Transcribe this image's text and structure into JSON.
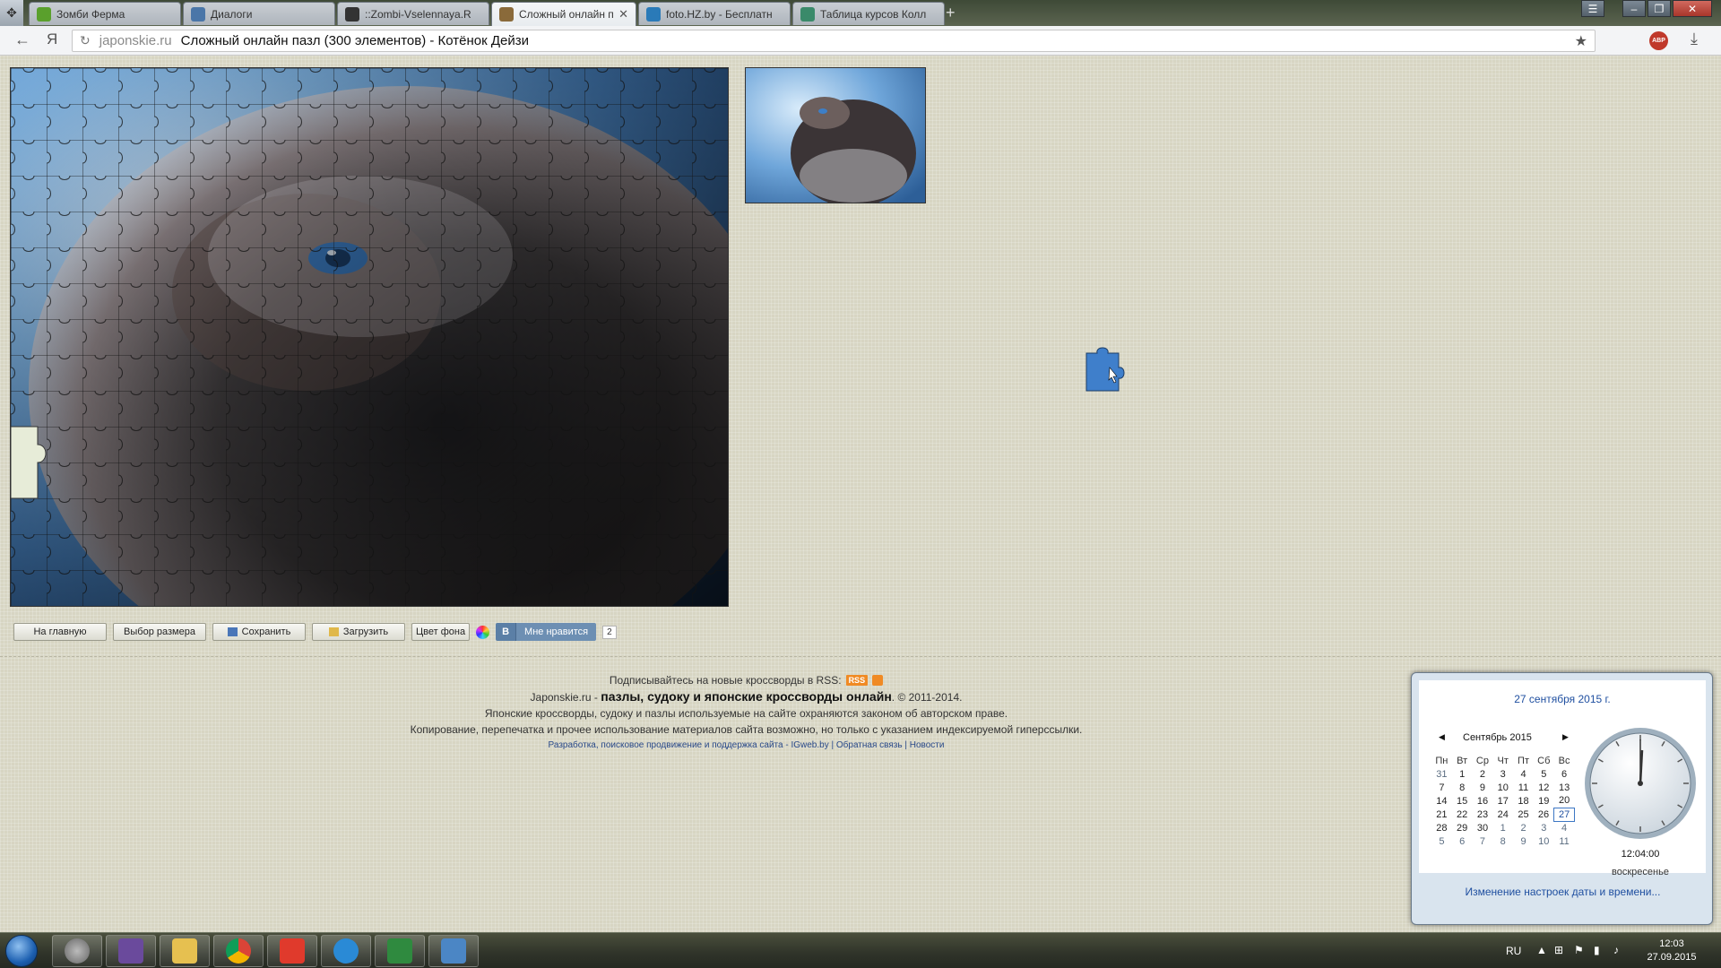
{
  "tabs": [
    {
      "title": "Зомби Ферма",
      "favicon_color": "#5aa02c"
    },
    {
      "title": "Диалоги",
      "favicon_color": "#4a76a8"
    },
    {
      "title": "::Zombi-Vselennaya.R",
      "favicon_color": "#333333"
    },
    {
      "title": "Сложный онлайн паз",
      "favicon_color": "#8a6a3a",
      "active": true
    },
    {
      "title": "foto.HZ.by - Бесплатн",
      "favicon_color": "#2a7ab8"
    },
    {
      "title": "Таблица курсов Колл",
      "favicon_color": "#3a8a6a"
    }
  ],
  "toolbar": {
    "domain": "japonskie.ru",
    "page_title": "Сложный онлайн пазл (300 элементов) - Котёнок Дейзи",
    "yandex_label": "Я"
  },
  "controls": {
    "home": "На главную",
    "size": "Выбор размера",
    "save": "Сохранить",
    "load": "Загрузить",
    "bg_color": "Цвет фона",
    "vk_b": "В",
    "vk_like": "Мне нравится",
    "vk_count": "2"
  },
  "footer": {
    "rss_text": "Подписывайтесь на новые кроссворды в RSS:",
    "rss_badge": "RSS",
    "line2_site": "Japonskie.ru -",
    "line2_bold": "пазлы, судоку и японские кроссворды онлайн",
    "line2_copy": ". © 2011-2014.",
    "line3": "Японские кроссворды, судоку и пазлы используемые на сайте охраняются законом об авторском праве.",
    "line4": "Копирование, перепечатка и прочее использование материалов сайта возможно, но только с указанием индексируемой гиперссылки.",
    "link_dev": "Разработка, поисковое продвижение и поддержка сайта - IGweb.by",
    "link_feedback": "Обратная связь",
    "link_news": "Новости"
  },
  "calendar": {
    "date_link": "27 сентября 2015 г.",
    "month_label": "Сентябрь 2015",
    "weekdays": [
      "Пн",
      "Вт",
      "Ср",
      "Чт",
      "Пт",
      "Сб",
      "Вс"
    ],
    "weeks": [
      [
        "31",
        "1",
        "2",
        "3",
        "4",
        "5",
        "6"
      ],
      [
        "7",
        "8",
        "9",
        "10",
        "11",
        "12",
        "13"
      ],
      [
        "14",
        "15",
        "16",
        "17",
        "18",
        "19",
        "20"
      ],
      [
        "21",
        "22",
        "23",
        "24",
        "25",
        "26",
        "27"
      ],
      [
        "28",
        "29",
        "30",
        "1",
        "2",
        "3",
        "4"
      ],
      [
        "5",
        "6",
        "7",
        "8",
        "9",
        "10",
        "11"
      ]
    ],
    "today": "27",
    "time": "12:04:00",
    "weekday": "воскресенье",
    "settings_link": "Изменение настроек даты и времени..."
  },
  "taskbar": {
    "lang": "RU",
    "time": "12:03",
    "date": "27.09.2015"
  },
  "colors": {
    "page_bg": "#d7d5c3",
    "link": "#1f4fa0",
    "vk": "#5b7fa6"
  }
}
